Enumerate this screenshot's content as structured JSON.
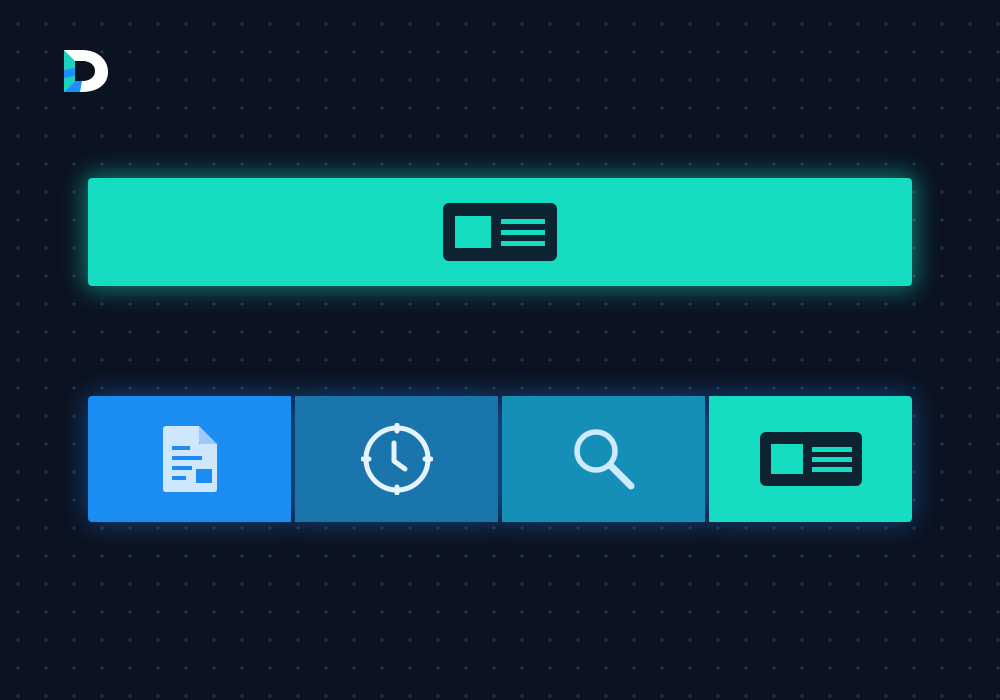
{
  "brand": {
    "logo_icon": "brand-d-logo",
    "logo_colors": [
      "#ffffff",
      "#19d3c0",
      "#1e8fff"
    ]
  },
  "banner": {
    "icon": "profile-card-icon",
    "color": "#16dcc2"
  },
  "tabs": [
    {
      "id": "document",
      "icon": "document-icon",
      "color": "#1b8cf2"
    },
    {
      "id": "clock",
      "icon": "clock-icon",
      "color": "#1b75ad"
    },
    {
      "id": "search",
      "icon": "search-icon",
      "color": "#158eb8"
    },
    {
      "id": "profile-card",
      "icon": "profile-card-icon",
      "color": "#16dcc2",
      "active": true
    }
  ],
  "colors": {
    "background": "#0b1220",
    "icon_dark": "#0f2433",
    "icon_light": "#e6f4ff",
    "teal_glow": "#16dcc2",
    "blue_glow": "#1e8cff"
  }
}
